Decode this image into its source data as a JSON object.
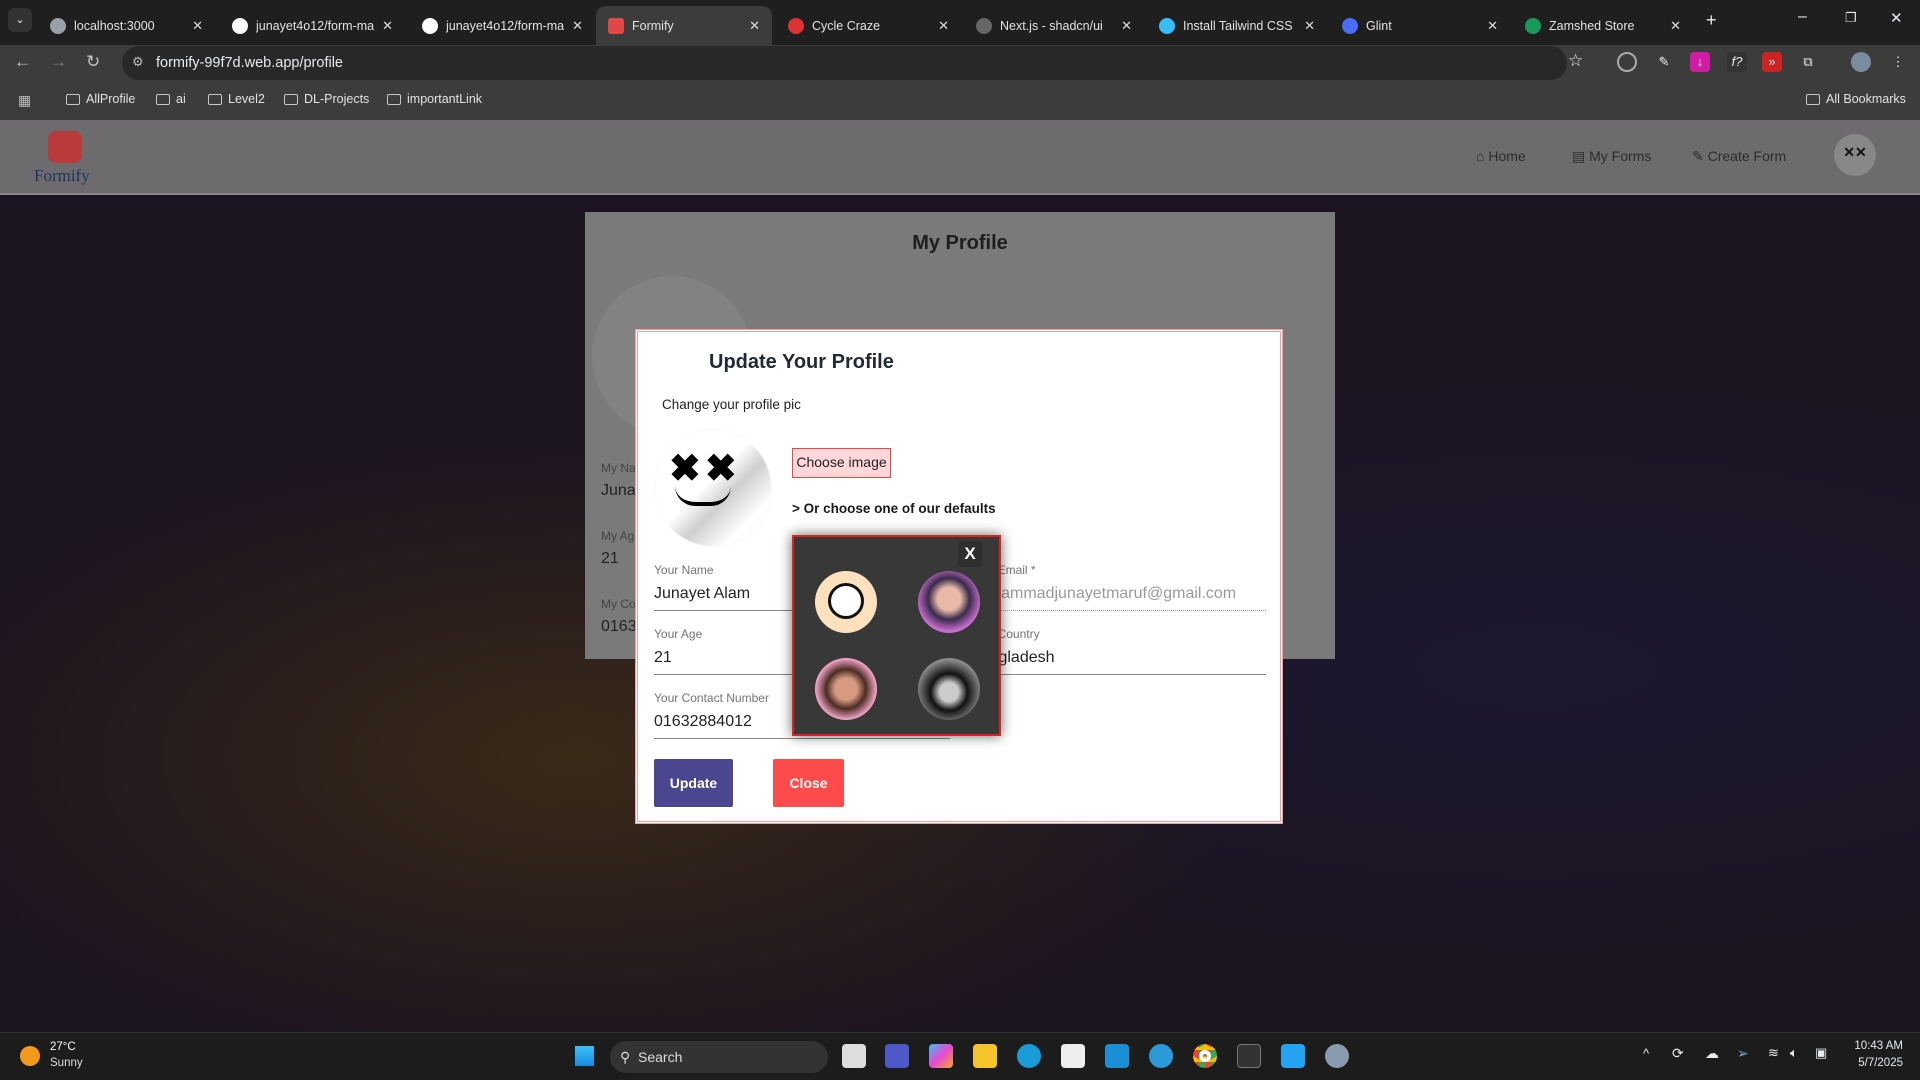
{
  "browser": {
    "tabs": [
      {
        "title": "localhost:3000"
      },
      {
        "title": "junayet4o12/form-ma"
      },
      {
        "title": "junayet4o12/form-ma"
      },
      {
        "title": "Formify",
        "active": true
      },
      {
        "title": "Cycle Craze"
      },
      {
        "title": "Next.js - shadcn/ui"
      },
      {
        "title": "Install Tailwind CSS w"
      },
      {
        "title": "Glint"
      },
      {
        "title": "Zamshed Store"
      }
    ],
    "url": "formify-99f7d.web.app/profile",
    "bookmarks": [
      "AllProfile",
      "ai",
      "Level2",
      "DL-Projects",
      "importantLink"
    ],
    "all_bookmarks": "All Bookmarks"
  },
  "app": {
    "logo": "Formify",
    "nav": [
      {
        "label": "Home",
        "icon": "home-icon"
      },
      {
        "label": "My Forms",
        "icon": "forms-icon"
      },
      {
        "label": "Create Form",
        "icon": "edit-icon"
      }
    ]
  },
  "profile_card": {
    "title": "My Profile",
    "labels": [
      "My Na",
      "My Ag",
      "My Co"
    ],
    "values": [
      "Juna",
      "21",
      "0163"
    ]
  },
  "modal": {
    "title": "Update Your Profile",
    "subtitle": "Change your profile pic",
    "choose_image": "Choose image",
    "defaults_link": "> Or choose one of our defaults",
    "fields": {
      "name": {
        "label": "Your Name",
        "value": "Junayet Alam"
      },
      "age": {
        "label": "Your Age",
        "value": "21"
      },
      "contact": {
        "label": "Your Contact Number",
        "value": "01632884012"
      },
      "email": {
        "label": "Your Email *",
        "value": "muhammadjunayetmaruf@gmail.com"
      },
      "country": {
        "label": "Your Country",
        "value": "Bangladesh"
      }
    },
    "update": "Update",
    "close": "Close",
    "popup_close": "X",
    "colors": {
      "update": "#4a4690",
      "close": "#ff4b4b",
      "choose_bg": "#ffd6da"
    }
  },
  "taskbar": {
    "weather_temp": "27°C",
    "weather_desc": "Sunny",
    "search": "Search",
    "time": "10:43 AM",
    "date": "5/7/2025"
  }
}
